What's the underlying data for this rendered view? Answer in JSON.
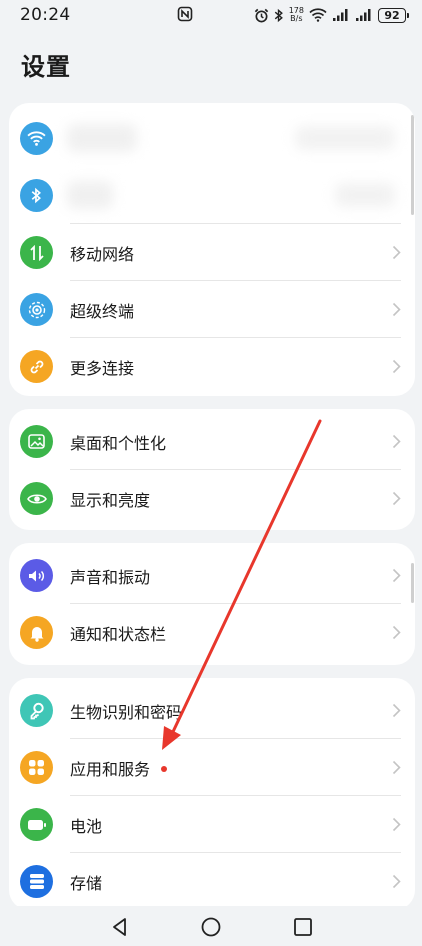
{
  "status_bar": {
    "time": "20:24",
    "speed_value": "178",
    "speed_unit": "B/s",
    "battery": "92"
  },
  "page": {
    "title": "设置"
  },
  "groups": [
    {
      "items": [
        {
          "label": "",
          "icon": "wifi-icon",
          "color": "#3aa3e3"
        },
        {
          "label": "",
          "icon": "bluetooth-icon",
          "color": "#3aa3e3"
        },
        {
          "label": "移动网络",
          "icon": "mobile-network-icon",
          "color": "#3bb54a"
        },
        {
          "label": "超级终端",
          "icon": "super-device-icon",
          "color": "#3aa3e3"
        },
        {
          "label": "更多连接",
          "icon": "link-icon",
          "color": "#f5a623"
        }
      ]
    },
    {
      "items": [
        {
          "label": "桌面和个性化",
          "icon": "wallpaper-icon",
          "color": "#3bb54a"
        },
        {
          "label": "显示和亮度",
          "icon": "eye-icon",
          "color": "#3bb54a"
        }
      ]
    },
    {
      "items": [
        {
          "label": "声音和振动",
          "icon": "speaker-icon",
          "color": "#5b5be6"
        },
        {
          "label": "通知和状态栏",
          "icon": "bell-icon",
          "color": "#f5a623"
        }
      ]
    },
    {
      "items": [
        {
          "label": "生物识别和密码",
          "icon": "key-icon",
          "color": "#3fc6b6"
        },
        {
          "label": "应用和服务",
          "icon": "apps-icon",
          "color": "#f5a623"
        },
        {
          "label": "电池",
          "icon": "battery-icon",
          "color": "#3bb54a"
        },
        {
          "label": "存储",
          "icon": "storage-icon",
          "color": "#1e6fe0"
        }
      ]
    }
  ],
  "colors": {
    "background": "#f1f3f5",
    "card": "#ffffff",
    "annotation_arrow": "#e8372c"
  }
}
